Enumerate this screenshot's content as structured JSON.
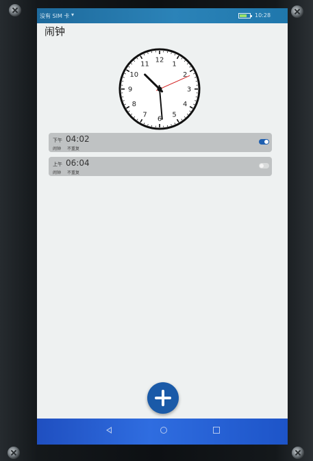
{
  "status_bar": {
    "carrier": "没有 SIM 卡",
    "time": "10:28",
    "battery_percent": 70,
    "icons": [
      "wifi-icon",
      "battery-icon"
    ]
  },
  "page": {
    "title": "闹钟"
  },
  "clock": {
    "numerals": [
      "12",
      "1",
      "2",
      "3",
      "4",
      "5",
      "6",
      "7",
      "8",
      "9",
      "10",
      "11"
    ],
    "hour": 10,
    "minute": 29,
    "second": 11,
    "colors": {
      "face": "#ffffff",
      "rim": "#111111",
      "hands": "#111111",
      "second_hand": "#d32020"
    }
  },
  "alarms": [
    {
      "period": "下午",
      "time": "04:02",
      "label": "闹钟",
      "repeat": "不重复",
      "enabled": true
    },
    {
      "period": "上午",
      "time": "06:04",
      "label": "闹钟",
      "repeat": "不重复",
      "enabled": false
    }
  ],
  "fab": {
    "icon": "plus-icon",
    "color": "#1a5aa8"
  },
  "nav_bar": {
    "icons": [
      "back-icon",
      "home-icon",
      "recent-apps-icon"
    ],
    "color": "#2f6de0"
  }
}
